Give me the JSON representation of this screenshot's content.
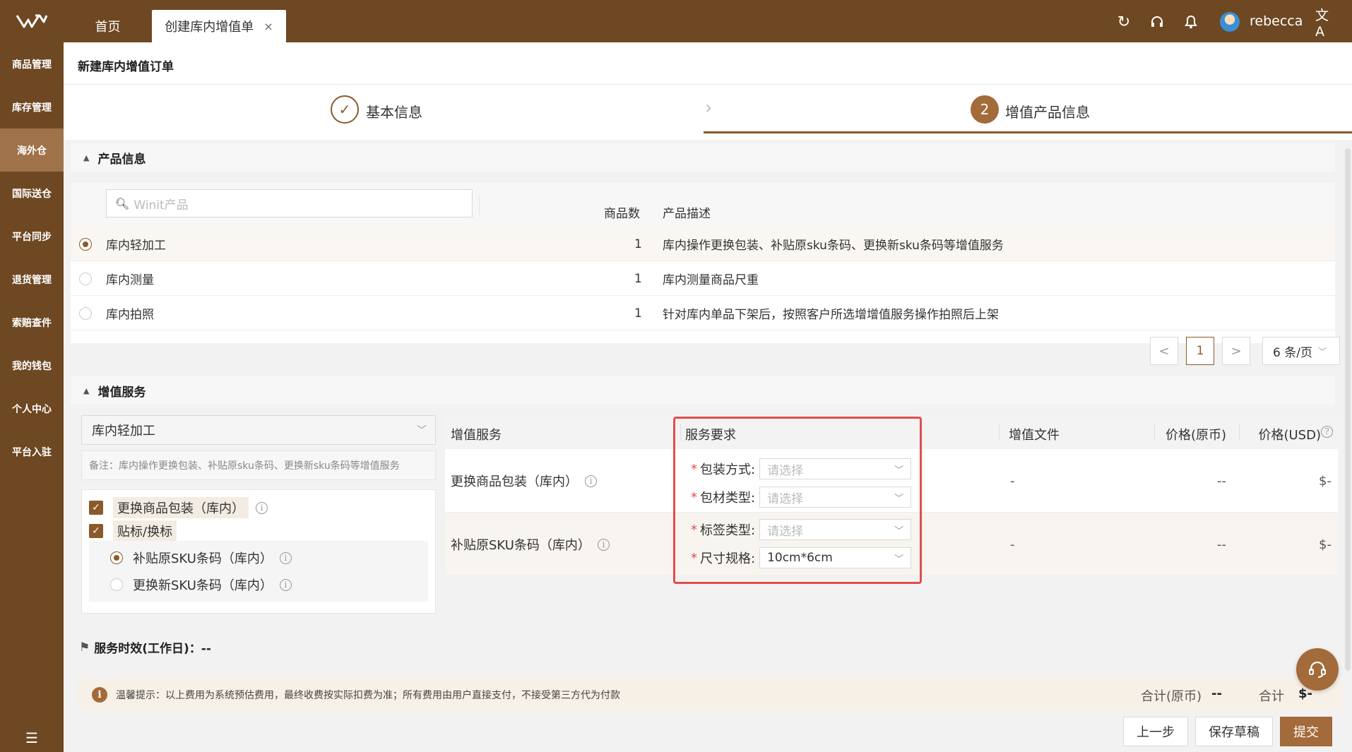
{
  "topbar": {
    "tabs": [
      {
        "label": "首页"
      },
      {
        "label": "创建库内增值单",
        "close": "×"
      }
    ],
    "username": "rebecca"
  },
  "sidebar": {
    "items": [
      {
        "label": "商品管理"
      },
      {
        "label": "库存管理"
      },
      {
        "label": "海外仓"
      },
      {
        "label": "国际送仓"
      },
      {
        "label": "平台同步"
      },
      {
        "label": "退货管理"
      },
      {
        "label": "索赔查件"
      },
      {
        "label": "我的钱包"
      },
      {
        "label": "个人中心"
      },
      {
        "label": "平台入驻"
      }
    ],
    "active_index": 2
  },
  "page": {
    "title": "新建库内增值订单",
    "steps": [
      {
        "index": "✓",
        "label": "基本信息",
        "status": "done"
      },
      {
        "index": "2",
        "label": "增值产品信息",
        "status": "active"
      }
    ]
  },
  "product_section": {
    "title": "产品信息",
    "search_placeholder": "Winit产品",
    "col_count": "商品数",
    "col_desc": "产品描述",
    "rows": [
      {
        "name": "库内轻加工",
        "count": "1",
        "desc": "库内操作更换包装、补贴原sku条码、更换新sku条码等增值服务",
        "selected": true
      },
      {
        "name": "库内测量",
        "count": "1",
        "desc": "库内测量商品尺重",
        "selected": false
      },
      {
        "name": "库内拍照",
        "count": "1",
        "desc": "针对库内单品下架后，按照客户所选增增值服务操作拍照后上架",
        "selected": false
      }
    ],
    "pagination": {
      "prev": "<",
      "current": "1",
      "next": ">",
      "page_size": "6 条/页"
    }
  },
  "value_section": {
    "title": "增值服务",
    "selected_product": "库内轻加工",
    "remark": "备注：库内操作更换包装、补贴原sku条码、更换新sku条码等增值服务",
    "checkbox_items": [
      {
        "label": "更换商品包装（库内）",
        "checked": true
      },
      {
        "label": "贴标/换标",
        "checked": true
      }
    ],
    "radio_items": [
      {
        "label": "补贴原SKU条码（库内）",
        "selected": true
      },
      {
        "label": "更换新SKU条码（库内）",
        "selected": false
      }
    ],
    "table": {
      "headers": {
        "service": "增值服务",
        "requirement": "服务要求",
        "file": "增值文件",
        "price_local": "价格(原币)",
        "price_usd": "价格(USD)"
      },
      "rows": [
        {
          "service": "更换商品包装（库内）",
          "fields": [
            {
              "label": "包装方式:",
              "value": "请选择",
              "filled": false
            },
            {
              "label": "包材类型:",
              "value": "请选择",
              "filled": false
            }
          ],
          "file": "-",
          "price_local": "--",
          "price_usd": "$-"
        },
        {
          "service": "补贴原SKU条码（库内）",
          "fields": [
            {
              "label": "标签类型:",
              "value": "请选择",
              "filled": false
            },
            {
              "label": "尺寸规格:",
              "value": "10cm*6cm",
              "filled": true
            }
          ],
          "file": "-",
          "price_local": "--",
          "price_usd": "$-"
        }
      ]
    }
  },
  "sla": "服务时效(工作日)：--",
  "tip": "温馨提示：以上费用为系统预估费用，最终收费按实际扣费为准；所有费用由用户直接支付，不接受第三方代为付款",
  "totals": {
    "local_label": "合计(原币)",
    "local_value": "--",
    "usd_label": "合计",
    "usd_value": "$-"
  },
  "buttons": {
    "prev": "上一步",
    "save_draft": "保存草稿",
    "submit": "提交"
  },
  "colors": {
    "brand": "#6e4822",
    "accent": "#a36a3a",
    "highlight_border": "#e34d4d"
  }
}
